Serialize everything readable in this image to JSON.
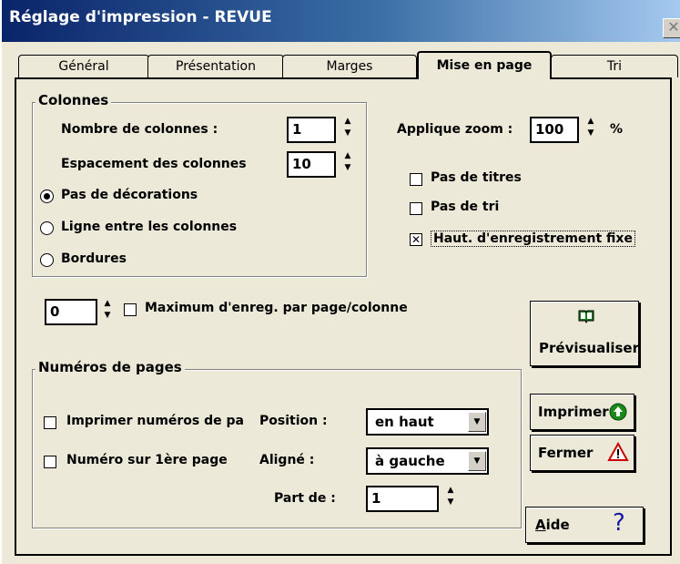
{
  "window": {
    "title": "Réglage d'impression - REVUE",
    "close_icon": "close-icon"
  },
  "tabs": [
    {
      "label": "Général",
      "active": false
    },
    {
      "label": "Présentation",
      "active": false
    },
    {
      "label": "Marges",
      "active": false
    },
    {
      "label": "Mise en page",
      "active": true
    },
    {
      "label": "Tri",
      "active": false
    }
  ],
  "columns": {
    "group_title": "Colonnes",
    "count_label": "Nombre de colonnes :",
    "count_value": "1",
    "spacing_label": "Espacement des colonnes",
    "spacing_value": "10",
    "options": [
      {
        "label": "Pas de décorations",
        "selected": true
      },
      {
        "label": "Ligne entre les colonnes",
        "selected": false
      },
      {
        "label": "Bordures",
        "selected": false
      }
    ]
  },
  "zoom": {
    "label": "Applique zoom :",
    "value": "100",
    "unit": "%"
  },
  "flags": [
    {
      "label": "Pas de titres",
      "checked": false
    },
    {
      "label": "Pas de tri",
      "checked": false
    },
    {
      "label": "Haut. d'enregistrement fixe",
      "checked": true
    }
  ],
  "max_records": {
    "value": "0",
    "label": "Maximum d'enreg. par page/colonne",
    "checked": false
  },
  "page_numbers": {
    "group_title": "Numéros de pages",
    "print_label": "Imprimer numéros de pa",
    "print_checked": false,
    "first_page_label": "Numéro sur 1ère page",
    "first_page_checked": false,
    "position_label": "Position :",
    "position_value": "en haut",
    "align_label": "Aligné :",
    "align_value": "à gauche",
    "start_label": "Part de :",
    "start_value": "1"
  },
  "buttons": {
    "preview": "Prévisualiser",
    "print": "Imprimer",
    "close": "Fermer",
    "help_a": "A",
    "help_rest": "ide",
    "help_glyph": "?"
  },
  "icons": {
    "preview": "book-icon",
    "print": "green-arrow-up-icon",
    "close": "warning-triangle-icon",
    "help": "question-icon"
  },
  "colors": {
    "titlebar_start": "#0a246a",
    "titlebar_end": "#a6caf0",
    "print_icon": "#1a8a1a",
    "close_icon": "#cc0000",
    "help_icon": "#1a1aa0"
  }
}
